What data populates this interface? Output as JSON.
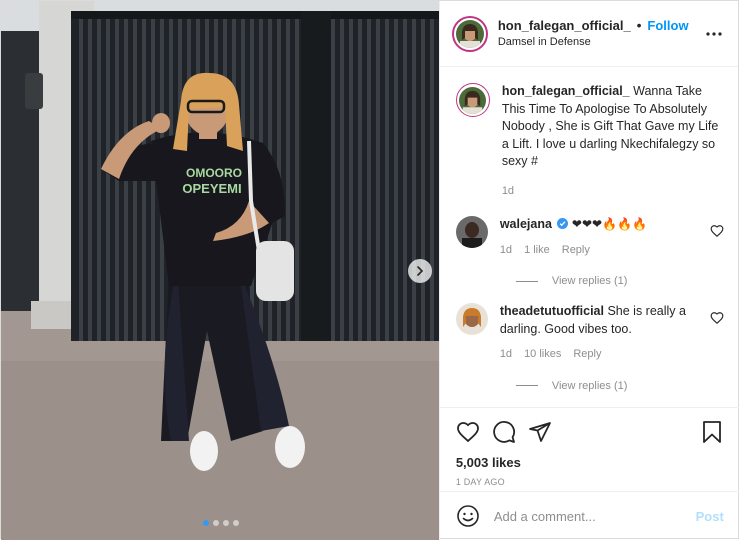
{
  "header": {
    "username": "hon_falegan_official_",
    "separator": "•",
    "follow_label": "Follow",
    "location": "Damsel in Defense",
    "more_icon": "more-horizontal-icon"
  },
  "media": {
    "shirt_text_line1": "OMOORO",
    "shirt_text_line2": "OPEYEMI",
    "carousel_total": 4,
    "carousel_active_index": 1
  },
  "caption": {
    "username": "hon_falegan_official_",
    "text": "Wanna Take This Time To Apologise To Absolutely Nobody , She is Gift That Gave my Life a Lift. I love u darling Nkechifalegzy so sexy #",
    "time": "1d"
  },
  "comments": [
    {
      "username": "walejana",
      "verified": true,
      "text": "❤❤❤🔥🔥🔥",
      "time": "1d",
      "likes": "1 like",
      "reply_label": "Reply",
      "view_replies": "View replies (1)"
    },
    {
      "username": "theadetutuofficial",
      "verified": false,
      "text": "She is really a darling. Good vibes too.",
      "time": "1d",
      "likes": "10 likes",
      "reply_label": "Reply",
      "view_replies": "View replies (1)"
    }
  ],
  "actions": {
    "likes_count": "5,003 likes",
    "posted_ago": "1 DAY AGO"
  },
  "add_comment": {
    "placeholder": "Add a comment...",
    "post_label": "Post"
  },
  "colors": {
    "link_blue": "#0095f6",
    "post_disabled": "#b2dffc",
    "muted": "#8e8e8e",
    "verified_blue": "#3897f0"
  }
}
